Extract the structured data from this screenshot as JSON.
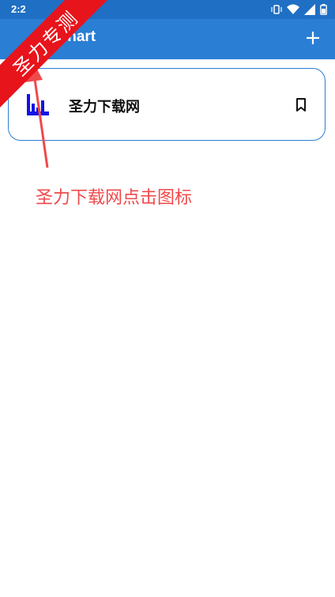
{
  "statusbar": {
    "time": "2:2"
  },
  "appbar": {
    "title": "Xchart",
    "add_icon": "plus-icon"
  },
  "list": {
    "items": [
      {
        "label": "圣力下载网",
        "icon": "bar-chart-icon",
        "action_icon": "bookmark-icon"
      }
    ]
  },
  "overlay": {
    "ribbon_text": "圣力专测",
    "annotation": "圣力下载网点击图标"
  },
  "colors": {
    "appbar": "#2a7ed4",
    "statusbar": "#1f6fc4",
    "card_border": "#2a7ed4",
    "chart_icon": "#1212e6",
    "annotation": "#f0494b",
    "ribbon": "#e8141b"
  }
}
